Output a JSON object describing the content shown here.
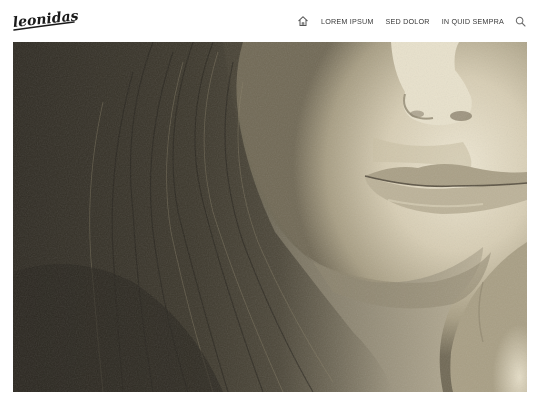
{
  "site": {
    "logo_text": "Leonidas"
  },
  "nav": {
    "home_icon": "home-icon",
    "items": [
      {
        "label": "LOREM IPSUM"
      },
      {
        "label": "SED DOLOR"
      },
      {
        "label": "IN QUID SEMPRA"
      }
    ],
    "search_icon": "search-icon"
  },
  "hero": {
    "subject": "sepia portrait photo"
  },
  "colors": {
    "text": "#3a3a3a",
    "sepia_light": "#e4dcc6",
    "sepia_dark": "#2e2a20"
  }
}
